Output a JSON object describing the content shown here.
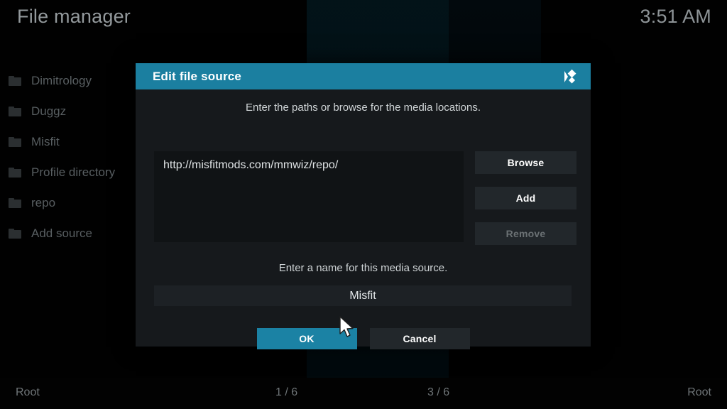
{
  "window": {
    "title": "File manager",
    "clock": "3:51 AM"
  },
  "colors": {
    "accent": "#1b7fa0",
    "dialog_bg": "#16191c",
    "button_bg": "#22272b",
    "text": "#cfd4d6",
    "disabled_text": "#6b7174"
  },
  "file_list": {
    "items": [
      {
        "label": "Dimitrology",
        "icon": "folder-icon"
      },
      {
        "label": "Duggz",
        "icon": "folder-icon"
      },
      {
        "label": "Misfit",
        "icon": "folder-icon"
      },
      {
        "label": "Profile directory",
        "icon": "folder-icon"
      },
      {
        "label": "repo",
        "icon": "folder-icon"
      },
      {
        "label": "Add source",
        "icon": "folder-icon"
      }
    ]
  },
  "dialog": {
    "title": "Edit file source",
    "logo_icon": "kodi-logo-icon",
    "paths_hint": "Enter the paths or browse for the media locations.",
    "paths": [
      "http://misfitmods.com/mmwiz/repo/"
    ],
    "side_buttons": [
      {
        "label": "Browse",
        "disabled": false
      },
      {
        "label": "Add",
        "disabled": false
      },
      {
        "label": "Remove",
        "disabled": true
      }
    ],
    "name_hint": "Enter a name for this media source.",
    "name_value": "Misfit",
    "actions": {
      "ok_label": "OK",
      "cancel_label": "Cancel"
    }
  },
  "statusbar": {
    "left": "Root",
    "middle_left": "1 / 6",
    "middle_right": "3 / 6",
    "right": "Root"
  }
}
